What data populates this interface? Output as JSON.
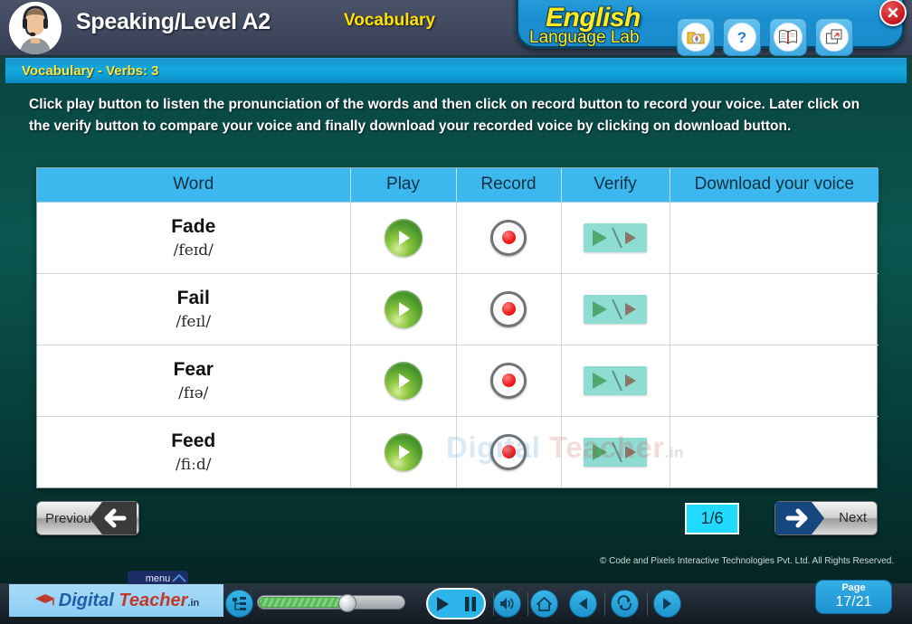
{
  "header": {
    "title": "Speaking/Level A2",
    "subtitle": "Vocabulary",
    "brand_line1": "English",
    "brand_line2": "Language Lab",
    "icons": [
      {
        "name": "media-folder-icon",
        "glyph": "◎"
      },
      {
        "name": "help-question-icon",
        "glyph": "?"
      },
      {
        "name": "dictionary-book-icon",
        "glyph": "☷"
      },
      {
        "name": "fullscreen-window-icon",
        "glyph": "❐"
      }
    ],
    "close_label": "✖"
  },
  "subbar": {
    "text": "Vocabulary - Verbs: 3"
  },
  "instructions": {
    "text": "Click play button to listen the pronunciation of the words and then click on record button to record your voice. Later click on the verify button to compare your voice and finally download your recorded voice by clicking on download button."
  },
  "table": {
    "columns": [
      "Word",
      "Play",
      "Record",
      "Verify",
      "Download your voice"
    ],
    "rows": [
      {
        "word": "Fade",
        "ipa": "/feɪd/",
        "play": "play-button",
        "record": "record-button",
        "verify": "verify-button",
        "download": ""
      },
      {
        "word": "Fail",
        "ipa": "/feɪl/",
        "play": "play-button",
        "record": "record-button",
        "verify": "verify-button",
        "download": ""
      },
      {
        "word": "Fear",
        "ipa": "/fɪə/",
        "play": "play-button",
        "record": "record-button",
        "verify": "verify-button",
        "download": ""
      },
      {
        "word": "Feed",
        "ipa": "/fiːd/",
        "play": "play-button",
        "record": "record-button",
        "verify": "verify-button",
        "download": ""
      }
    ]
  },
  "watermark": {
    "part1": "Digital",
    "part2": " Teacher",
    "part3": ".in"
  },
  "navigation": {
    "previous_label": "Previous",
    "next_label": "Next",
    "page_indicator": "1/6"
  },
  "copyright": "© Code and Pixels Interactive Technologies  Pvt. Ltd. All Rights Reserved.",
  "toolbar": {
    "logo_part1": "Digital",
    "logo_part2": " Teacher",
    "logo_part3": ".in",
    "menu_label": "menu",
    "page_badge_label": "Page",
    "page_badge_value": "17/21",
    "slider_value": 56,
    "controls": [
      {
        "name": "index-list-icon"
      },
      {
        "name": "play-icon"
      },
      {
        "name": "pause-icon"
      },
      {
        "name": "volume-icon"
      },
      {
        "name": "home-icon"
      },
      {
        "name": "previous-icon"
      },
      {
        "name": "refresh-icon"
      },
      {
        "name": "next-icon"
      }
    ]
  },
  "colors": {
    "accent_blue": "#3cb8ef",
    "brand_yellow": "#ffeb1f",
    "header_gray": "#414a60",
    "background_teal": "#0b5650",
    "play_green": "#8cc63f",
    "record_red": "#f42020",
    "verify_mint": "#8fdcd2",
    "close_red": "#cc1f24"
  }
}
